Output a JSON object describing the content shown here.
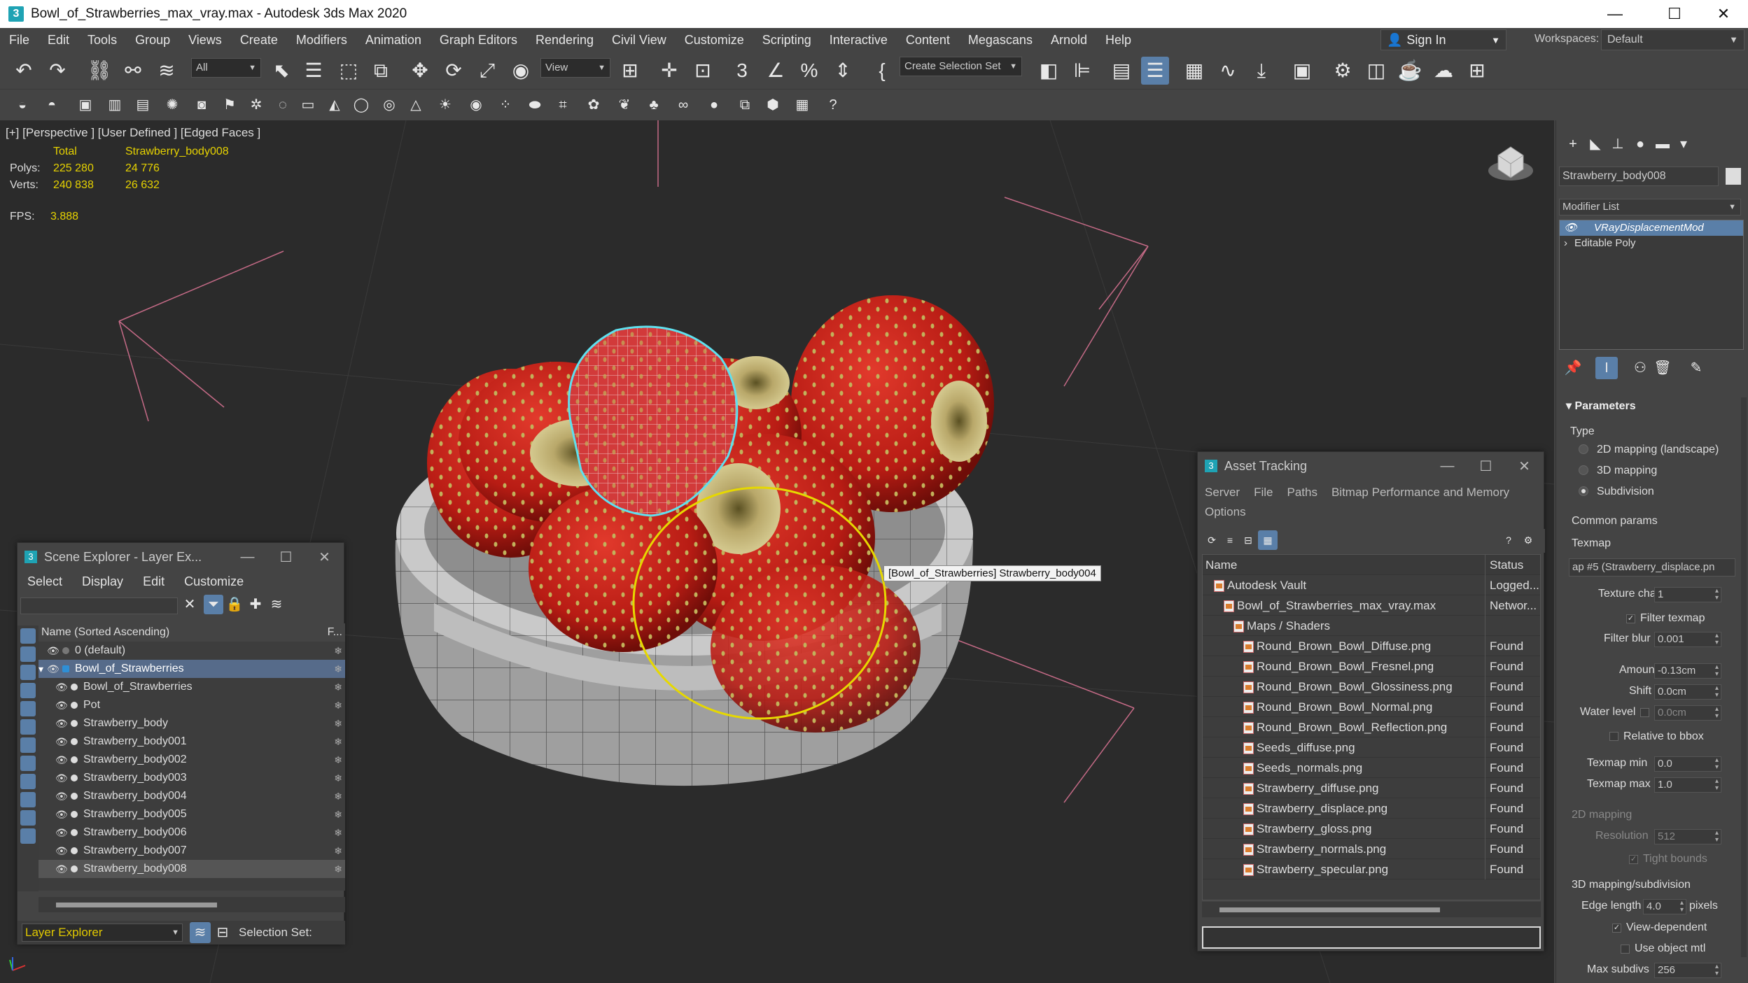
{
  "window": {
    "title": "Bowl_of_Strawberries_max_vray.max - Autodesk 3ds Max 2020",
    "app_icon": "3"
  },
  "menu": [
    "File",
    "Edit",
    "Tools",
    "Group",
    "Views",
    "Create",
    "Modifiers",
    "Animation",
    "Graph Editors",
    "Rendering",
    "Civil View",
    "Customize",
    "Scripting",
    "Interactive",
    "Content",
    "Megascans",
    "Arnold",
    "Help"
  ],
  "signin": {
    "label": "Sign In"
  },
  "workspaces": {
    "label": "Workspaces:",
    "value": "Default"
  },
  "toolbar": {
    "filter_value": "All",
    "refcoord_value": "View",
    "selection_set_placeholder": "Create Selection Set"
  },
  "viewport": {
    "label": "[+] [Perspective ] [User Defined ] [Edged Faces ]",
    "stats": {
      "col_total": "Total",
      "col_object": "Strawberry_body008",
      "polys_label": "Polys:",
      "polys_total": "225 280",
      "polys_obj": "24 776",
      "verts_label": "Verts:",
      "verts_total": "240 838",
      "verts_obj": "26 632"
    },
    "fps_label": "FPS:",
    "fps_value": "3.888",
    "tooltip": "[Bowl_of_Strawberries] Strawberry_body004"
  },
  "scene_explorer": {
    "title": "Scene Explorer - Layer Ex...",
    "menu": [
      "Select",
      "Display",
      "Edit",
      "Customize"
    ],
    "header": "Name (Sorted Ascending)",
    "header_right": "F...",
    "rows": [
      {
        "label": "0 (default)",
        "indent": 1
      },
      {
        "label": "Bowl_of_Strawberries",
        "indent": 1,
        "selected": true
      },
      {
        "label": "Bowl_of_Strawberries",
        "indent": 2
      },
      {
        "label": "Pot",
        "indent": 2
      },
      {
        "label": "Strawberry_body",
        "indent": 2
      },
      {
        "label": "Strawberry_body001",
        "indent": 2
      },
      {
        "label": "Strawberry_body002",
        "indent": 2
      },
      {
        "label": "Strawberry_body003",
        "indent": 2
      },
      {
        "label": "Strawberry_body004",
        "indent": 2
      },
      {
        "label": "Strawberry_body005",
        "indent": 2
      },
      {
        "label": "Strawberry_body006",
        "indent": 2
      },
      {
        "label": "Strawberry_body007",
        "indent": 2
      },
      {
        "label": "Strawberry_body008",
        "indent": 2,
        "highlight": true
      }
    ],
    "bottom_combo": "Layer Explorer",
    "selection_set_label": "Selection Set:"
  },
  "asset_tracking": {
    "title": "Asset Tracking",
    "menu": [
      "Server",
      "File",
      "Paths",
      "Bitmap Performance and Memory",
      "Options"
    ],
    "col_name": "Name",
    "col_status": "Status",
    "rows": [
      {
        "name": "Autodesk Vault",
        "status": "Logged...",
        "indent": 0
      },
      {
        "name": "Bowl_of_Strawberries_max_vray.max",
        "status": "Networ...",
        "indent": 1
      },
      {
        "name": "Maps / Shaders",
        "status": "",
        "indent": 2
      },
      {
        "name": "Round_Brown_Bowl_Diffuse.png",
        "status": "Found",
        "indent": 3
      },
      {
        "name": "Round_Brown_Bowl_Fresnel.png",
        "status": "Found",
        "indent": 3
      },
      {
        "name": "Round_Brown_Bowl_Glossiness.png",
        "status": "Found",
        "indent": 3
      },
      {
        "name": "Round_Brown_Bowl_Normal.png",
        "status": "Found",
        "indent": 3
      },
      {
        "name": "Round_Brown_Bowl_Reflection.png",
        "status": "Found",
        "indent": 3
      },
      {
        "name": "Seeds_diffuse.png",
        "status": "Found",
        "indent": 3
      },
      {
        "name": "Seeds_normals.png",
        "status": "Found",
        "indent": 3
      },
      {
        "name": "Strawberry_diffuse.png",
        "status": "Found",
        "indent": 3
      },
      {
        "name": "Strawberry_displace.png",
        "status": "Found",
        "indent": 3
      },
      {
        "name": "Strawberry_gloss.png",
        "status": "Found",
        "indent": 3
      },
      {
        "name": "Strawberry_normals.png",
        "status": "Found",
        "indent": 3
      },
      {
        "name": "Strawberry_specular.png",
        "status": "Found",
        "indent": 3
      }
    ]
  },
  "command_panel": {
    "object_name": "Strawberry_body008",
    "modifier_list": "Modifier List",
    "stack": [
      "VRayDisplacementMod",
      "Editable Poly"
    ],
    "rollout": "Parameters",
    "type_label": "Type",
    "types": [
      "2D mapping (landscape)",
      "3D mapping",
      "Subdivision"
    ],
    "selected_type": "Subdivision",
    "common_params": "Common params",
    "texmap_label": "Texmap",
    "texmap_value": "ap #5 (Strawberry_displace.pn",
    "texture_chan_label": "Texture chan",
    "texture_chan_value": "1",
    "filter_texmap": "Filter texmap",
    "filter_blur_label": "Filter blur",
    "filter_blur_value": "0.001",
    "amount_label": "Amount",
    "amount_value": "-0.13cm",
    "shift_label": "Shift",
    "shift_value": "0.0cm",
    "water_level_label": "Water level",
    "water_level_value": "0.0cm",
    "relative_bbox": "Relative to bbox",
    "texmap_min_label": "Texmap min",
    "texmap_min_value": "0.0",
    "texmap_max_label": "Texmap max",
    "texmap_max_value": "1.0",
    "mapping2d": "2D mapping",
    "resolution_label": "Resolution",
    "resolution_value": "512",
    "tight_bounds": "Tight bounds",
    "mapping3d": "3D mapping/subdivision",
    "edge_length_label": "Edge length",
    "edge_length_value": "4.0",
    "pixels_label": "pixels",
    "view_dependent": "View-dependent",
    "use_object_mtl": "Use object mtl",
    "max_subdivs_label": "Max subdivs",
    "max_subdivs_value": "256"
  }
}
